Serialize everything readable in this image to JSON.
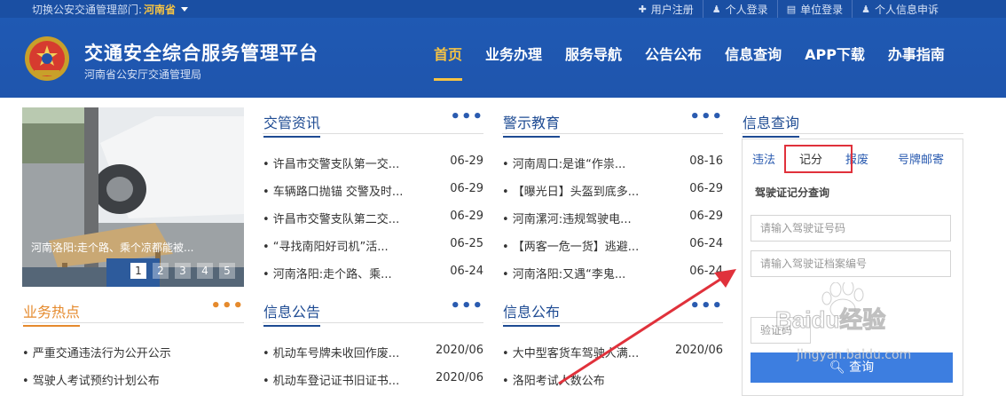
{
  "topbar": {
    "region_label": "切换公安交通管理部门:",
    "region_value": "河南省",
    "links": [
      {
        "icon": "plus-icon",
        "glyph": "✚",
        "label": "用户注册"
      },
      {
        "icon": "user-icon",
        "glyph": "♟",
        "label": "个人登录"
      },
      {
        "icon": "document-icon",
        "glyph": "▤",
        "label": "单位登录"
      },
      {
        "icon": "user-icon",
        "glyph": "♟",
        "label": "个人信息申诉"
      }
    ]
  },
  "header": {
    "title": "交通安全综合服务管理平台",
    "subtitle": "河南省公安厅交通管理局",
    "nav": [
      "首页",
      "业务办理",
      "服务导航",
      "公告公布",
      "信息查询",
      "APP下载",
      "办事指南"
    ],
    "nav_active": "首页"
  },
  "slider": {
    "caption": "河南洛阳:走个路、乘个凉都能被...",
    "pages": [
      "1",
      "2",
      "3",
      "4",
      "5"
    ],
    "active_page": "1"
  },
  "news": {
    "title": "交管资讯",
    "more": "•••",
    "items": [
      {
        "title": "• 许昌市交警支队第一交...",
        "date": "06-29"
      },
      {
        "title": "• 车辆路口抛锚 交警及时...",
        "date": "06-29"
      },
      {
        "title": "• 许昌市交警支队第二交...",
        "date": "06-29"
      },
      {
        "title": "• “寻找南阳好司机”活...",
        "date": "06-25"
      },
      {
        "title": "• 河南洛阳:走个路、乘...",
        "date": "06-24"
      }
    ]
  },
  "warning": {
    "title": "警示教育",
    "more": "•••",
    "items": [
      {
        "title": "• 河南周口:是谁“作祟...",
        "date": "08-16"
      },
      {
        "title": "• 【曝光日】头盔到底多...",
        "date": "06-29"
      },
      {
        "title": "• 河南漯河:违规驾驶电...",
        "date": "06-29"
      },
      {
        "title": "• 【两客一危一货】逃避...",
        "date": "06-24"
      },
      {
        "title": "• 河南洛阳:又遇“李鬼...",
        "date": "06-24"
      }
    ]
  },
  "hot": {
    "title": "业务热点",
    "more": "•••",
    "items": [
      {
        "title": "• 严重交通违法行为公开公示"
      },
      {
        "title": "• 驾驶人考试预约计划公布"
      }
    ]
  },
  "notice": {
    "title": "信息公告",
    "more": "•••",
    "items": [
      {
        "title": "• 机动车号牌未收回作废...",
        "date": "2020/06"
      },
      {
        "title": "• 机动车登记证书旧证书...",
        "date": "2020/06"
      }
    ]
  },
  "publish": {
    "title": "信息公布",
    "more": "•••",
    "items": [
      {
        "title": "• 大中型客货车驾驶人满...",
        "date": "2020/06"
      },
      {
        "title": "• 洛阳考试人数公布",
        "date": ""
      }
    ]
  },
  "query": {
    "title": "信息查询",
    "tabs": [
      "违法",
      "记分",
      "报废",
      "号牌邮寄"
    ],
    "active_tab": "记分",
    "form_title": "驾驶证记分查询",
    "placeholder_license": "请输入驾驶证号码",
    "placeholder_file": "请输入驾驶证档案编号",
    "placeholder_captcha": "验证码",
    "button": "查询"
  },
  "watermark": {
    "brand": "Baidu经验",
    "url": "jingyan.baidu.com"
  },
  "colors": {
    "brand_blue": "#1f57b0",
    "accent_gold": "#f6c343",
    "link_blue": "#1e4b93",
    "hot_orange": "#e58a2d",
    "highlight_red": "#e0313b"
  }
}
